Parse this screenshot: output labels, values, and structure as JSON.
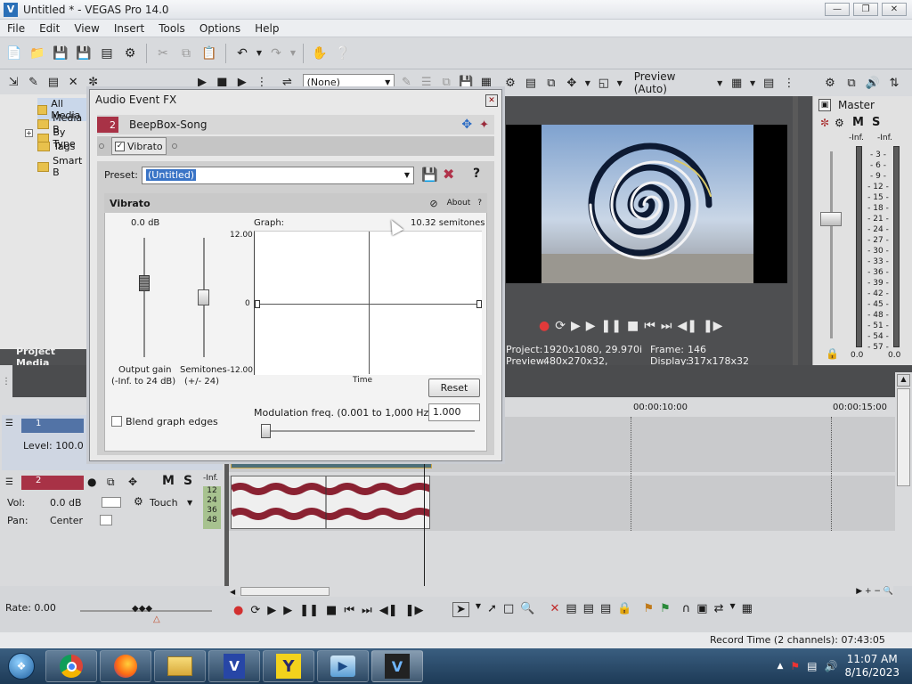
{
  "window": {
    "title": "Untitled * - VEGAS Pro 14.0"
  },
  "menu": [
    "File",
    "Edit",
    "View",
    "Insert",
    "Tools",
    "Options",
    "Help"
  ],
  "explorer": {
    "items": [
      "All Media",
      "Media B",
      "By Type",
      "Tags",
      "Smart B"
    ],
    "tab_label": "Project Media",
    "filter_value": "(None)"
  },
  "preview": {
    "quality": "Preview (Auto)",
    "project_label": "Project:",
    "project_value": "1920x1080, 29.970i",
    "frame_label": "Frame:",
    "frame_value": "146",
    "preview_label": "Preview:",
    "preview_value": "480x270x32, 29.970p",
    "display_label": "Display:",
    "display_value": "317x178x32"
  },
  "master": {
    "title": "Master",
    "m": "M",
    "s": "S",
    "inf_left": "-Inf.",
    "inf_right": "-Inf.",
    "scale": [
      "3",
      "6",
      "9",
      "12",
      "15",
      "18",
      "21",
      "24",
      "27",
      "30",
      "33",
      "36",
      "39",
      "42",
      "45",
      "48",
      "51",
      "54",
      "57"
    ],
    "val_left": "0.0",
    "val_right": "0.0"
  },
  "timeline": {
    "ruler": [
      "00:00:10:00",
      "00:00:15:00"
    ],
    "track1": {
      "num": "1",
      "level": "Level: 100.0 %"
    },
    "track2": {
      "num": "2",
      "m": "M",
      "s": "S",
      "vol_label": "Vol:",
      "vol_value": "0.0 dB",
      "pan_label": "Pan:",
      "pan_value": "Center",
      "automation": "Touch",
      "meter_inf": "-Inf.",
      "meter_scale": [
        "12",
        "24",
        "36",
        "48"
      ]
    }
  },
  "bottom": {
    "rate": "Rate: 0.00",
    "record_time": "Record Time (2 channels): 07:43:05"
  },
  "taskbar": {
    "time": "11:07 AM",
    "date": "8/16/2023"
  },
  "dialog": {
    "title": "Audio Event FX",
    "track_num": "2",
    "event_name": "BeepBox-Song",
    "plugin_chain": "Vibrato",
    "preset_label": "Preset:",
    "preset_value": "(Untitled)",
    "help": "?",
    "panel_title": "Vibrato",
    "about": "About",
    "about_help": "?",
    "gain_value": "0.0 dB",
    "gain_label1": "Output gain",
    "gain_label2": "(-Inf. to 24 dB)",
    "semi_label1": "Semitones",
    "semi_label2": "(+/- 24)",
    "graph_label": "Graph:",
    "graph_value": "10.32 semitones",
    "y_top": "12.00",
    "y_mid": "0",
    "y_bot": "-12.00",
    "time_label": "Time",
    "reset": "Reset",
    "blend": "Blend graph edges",
    "mod_label": "Modulation freq. (0.001 to 1,000 Hz):",
    "mod_value": "1.000"
  },
  "colors": {
    "accent": "#3a74c6",
    "track_red": "#a83246",
    "wave": "#8a2232"
  }
}
